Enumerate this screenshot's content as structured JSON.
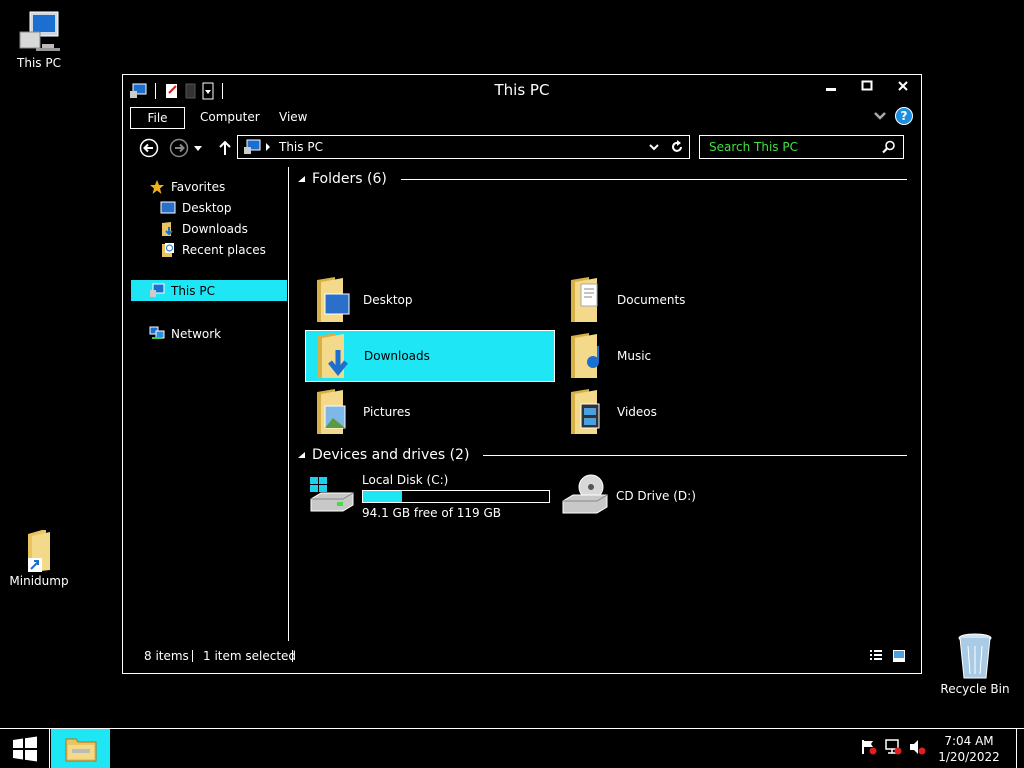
{
  "desktop": {
    "icons": [
      {
        "label": "This PC",
        "icon": "computer-icon"
      },
      {
        "label": "Minidump",
        "icon": "folder-shortcut-icon"
      },
      {
        "label": "Recycle Bin",
        "icon": "recycle-bin-icon"
      }
    ]
  },
  "window": {
    "title": "This PC",
    "controls": {
      "minimize": "minimize-icon",
      "maximize": "maximize-icon",
      "close": "close-icon"
    },
    "ribbon": {
      "tabs": [
        "File",
        "Computer",
        "View"
      ]
    },
    "address": {
      "path": "This PC"
    },
    "search": {
      "placeholder": "Search This PC"
    },
    "nav": {
      "favorites_label": "Favorites",
      "favorites": [
        "Desktop",
        "Downloads",
        "Recent places"
      ],
      "this_pc": "This PC",
      "network": "Network"
    },
    "content": {
      "folders_header": "Folders (6)",
      "folders": [
        {
          "label": "Desktop",
          "icon": "desktop-folder-icon"
        },
        {
          "label": "Documents",
          "icon": "documents-folder-icon"
        },
        {
          "label": "Downloads",
          "icon": "downloads-folder-icon",
          "selected": true
        },
        {
          "label": "Music",
          "icon": "music-folder-icon"
        },
        {
          "label": "Pictures",
          "icon": "pictures-folder-icon"
        },
        {
          "label": "Videos",
          "icon": "videos-folder-icon"
        }
      ],
      "devices_header": "Devices and drives (2)",
      "drives": [
        {
          "label": "Local Disk (C:)",
          "free": "94.1 GB free of 119 GB",
          "used_fraction": 0.209
        },
        {
          "label": "CD Drive (D:)"
        }
      ]
    },
    "status": {
      "items": "8 items",
      "selected": "1 item selected"
    }
  },
  "taskbar": {
    "time": "7:04 AM",
    "date": "1/20/2022"
  },
  "colors": {
    "accent": "#1ee6f5",
    "search_text": "#3fe03f"
  }
}
